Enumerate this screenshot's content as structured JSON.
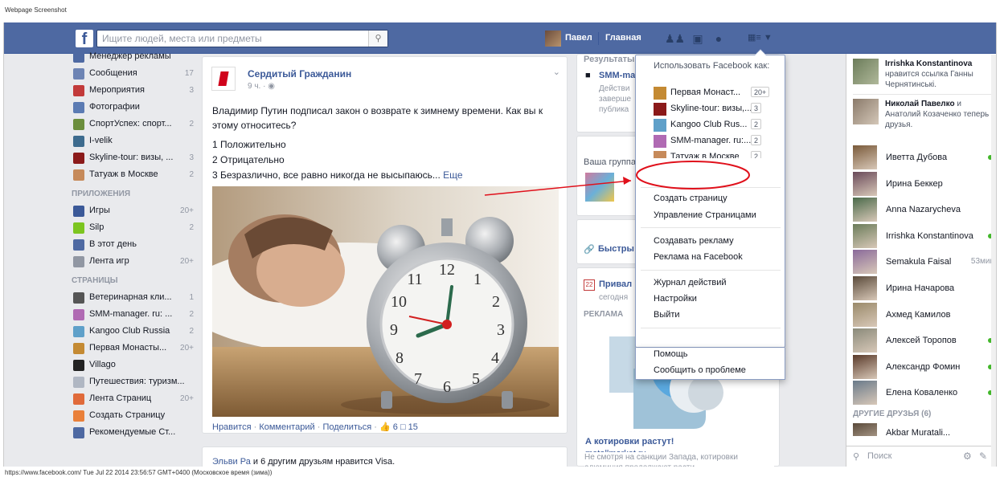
{
  "caption": "Webpage Screenshot",
  "footer": "https://www.facebook.com/ Tue Jul 22 2014 23:56:57 GMT+0400 (Московское время (зима))",
  "topbar": {
    "logo": "f",
    "search_placeholder": "Ищите людей, места или предметы",
    "user": "Павел",
    "home": "Главная"
  },
  "leftnav": {
    "top_items": [
      {
        "label": "Менеджер рекламы",
        "count": "",
        "color": "#4e69a2"
      },
      {
        "label": "Сообщения",
        "count": "17",
        "color": "#6d84b4"
      },
      {
        "label": "Мероприятия",
        "count": "3",
        "color": "#c23a3a"
      },
      {
        "label": "Фотографии",
        "count": "",
        "color": "#5b7bb3"
      },
      {
        "label": "СпортУспех: спорт...",
        "count": "2",
        "color": "#6b8e3d"
      },
      {
        "label": "I-velik",
        "count": "",
        "color": "#3d6b8e"
      },
      {
        "label": "Skyline-tour: визы, ...",
        "count": "3",
        "color": "#8b1a1a"
      },
      {
        "label": "Татуаж в Москве",
        "count": "2",
        "color": "#c68a5a"
      }
    ],
    "apps_header": "ПРИЛОЖЕНИЯ",
    "apps": [
      {
        "label": "Игры",
        "count": "20+",
        "color": "#3b5998"
      },
      {
        "label": "Silp",
        "count": "2",
        "color": "#7cc520"
      },
      {
        "label": "В этот день",
        "count": "",
        "color": "#4e69a2"
      },
      {
        "label": "Лента игр",
        "count": "20+",
        "color": "#9197a3"
      }
    ],
    "pages_header": "СТРАНИЦЫ",
    "pages": [
      {
        "label": "Ветеринарная кли...",
        "count": "1",
        "color": "#555"
      },
      {
        "label": "SMM-manager. ru: ...",
        "count": "2",
        "color": "#b06ab3"
      },
      {
        "label": "Kangoo Club Russia",
        "count": "2",
        "color": "#5fa0c9"
      },
      {
        "label": "Первая Монасты...",
        "count": "20+",
        "color": "#c48a33"
      },
      {
        "label": "Villago",
        "count": "",
        "color": "#222"
      },
      {
        "label": "Путешествия: туризм...",
        "count": "",
        "color": "#b0b7c3"
      },
      {
        "label": "Лента Страниц",
        "count": "20+",
        "color": "#e06a3a"
      },
      {
        "label": "Создать Страницу",
        "count": "",
        "color": "#e9803a"
      },
      {
        "label": "Рекомендуемые Ст...",
        "count": "",
        "color": "#4e69a2"
      }
    ]
  },
  "story": {
    "page_name": "Сердитый Гражданин",
    "time": "9 ч. · ",
    "text": "Владимир Путин подписал закон о возврате к зимнему времени. Как вы к этому относитесь?",
    "options": [
      "1 Положительно",
      "2 Отрицательно",
      "3 Безразлично, все равно никогда не высыпаюсь..."
    ],
    "more": "Еще",
    "like": "Нравится",
    "comment": "Комментарий",
    "share": "Поделиться",
    "likes_count": "6",
    "comments_count": "15"
  },
  "story2": {
    "name": "Эльви Ра",
    "text": " и 6 другим друзьям нравится Visa."
  },
  "rightcol": {
    "results_head": "Результаты",
    "smm_title": "SMM-ma",
    "smm_sub": [
      "Действи",
      "заверше",
      "публикa"
    ],
    "group_head": "Ваша группа",
    "quick": "Быстры",
    "event_title": "Привал",
    "event_sub": "сегодня",
    "ad_head": "РЕКЛАМА",
    "ad_title": "А котировки растут!",
    "ad_domain": "metallmarket.ru",
    "ad_text": "Не смотря на санкции Запада, котировки алюминия продолжают расти."
  },
  "dropdown": {
    "use_as": "Использовать Facebook как:",
    "pages": [
      {
        "name": "Первая Монаст...",
        "count": "20+",
        "color": "#c48a33"
      },
      {
        "name": "Skyline-tour: визы,...",
        "count": "3",
        "color": "#8b1a1a"
      },
      {
        "name": "Kangoo Club Rus...",
        "count": "2",
        "color": "#5fa0c9"
      },
      {
        "name": "SMM-manager. ru:...",
        "count": "2",
        "color": "#b06ab3"
      },
      {
        "name": "Татуаж в Москве",
        "count": "2",
        "color": "#c68a5a"
      }
    ],
    "create_page": "Создать страницу",
    "manage_pages": "Управление Страницами",
    "create_ad": "Создавать рекламу",
    "ads_on_fb": "Реклама на Facebook",
    "activity_log": "Журнал действий",
    "settings": "Настройки",
    "logout": "Выйти",
    "help": "Помощь",
    "report": "Сообщить о проблеме"
  },
  "chat": {
    "feed": [
      {
        "name": "Irrishka Konstantinova",
        "text": "нравится ссылка Ганны Чернятинськi."
      },
      {
        "name": "Николай Павелко",
        "text": " и Анатолий Козаченко теперь друзья."
      }
    ],
    "friends": [
      {
        "name": "Иветта Дубова",
        "status": "online",
        "idle": ""
      },
      {
        "name": "Ирина Беккер",
        "status": "",
        "idle": ""
      },
      {
        "name": "Anna Nazarycheva",
        "status": "",
        "idle": ""
      },
      {
        "name": "Irrishka Konstantinova",
        "status": "online",
        "idle": ""
      },
      {
        "name": "Semakula Faisal",
        "status": "idle",
        "idle": "53мин"
      },
      {
        "name": "Ирина Начарова",
        "status": "",
        "idle": ""
      },
      {
        "name": "Ахмед Камилов",
        "status": "",
        "idle": ""
      },
      {
        "name": "Алексей Торопов",
        "status": "online",
        "idle": ""
      },
      {
        "name": "Александр Фомин",
        "status": "online",
        "idle": ""
      },
      {
        "name": "Елена Коваленко",
        "status": "online",
        "idle": ""
      }
    ],
    "other_head": "ДРУГИЕ ДРУЗЬЯ (6)",
    "other_first": "Akbar Muratali...",
    "search_placeholder": "Поиск"
  },
  "colors": {
    "brand": "#3b5998",
    "topbar": "#4e69a2",
    "online": "#42b72a",
    "annotation": "#e0101b"
  }
}
